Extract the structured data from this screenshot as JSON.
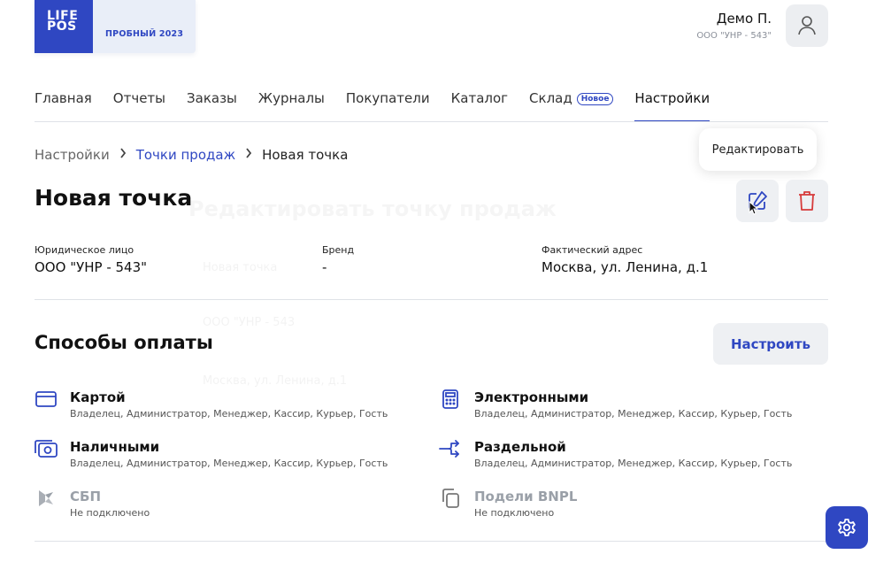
{
  "brand": {
    "logo_line1": "LIFE",
    "logo_line2": "POS",
    "trial_label": "ПРОБНЫЙ 2023"
  },
  "user": {
    "name": "Демо П.",
    "org": "ООО \"УНР - 543\""
  },
  "nav": {
    "items": [
      {
        "label": "Главная"
      },
      {
        "label": "Отчеты"
      },
      {
        "label": "Заказы"
      },
      {
        "label": "Журналы"
      },
      {
        "label": "Покупатели"
      },
      {
        "label": "Каталог"
      },
      {
        "label": "Склад",
        "badge": "Новое"
      },
      {
        "label": "Настройки",
        "active": true
      }
    ]
  },
  "breadcrumb": {
    "root": "Настройки",
    "parent": "Точки продаж",
    "current": "Новая точка"
  },
  "tooltip": {
    "text": "Редактировать"
  },
  "page": {
    "title": "Новая точка",
    "ghost_title": "Редактировать точку продаж"
  },
  "details": {
    "legal_label": "Юридическое лицо",
    "legal_value": "ООО \"УНР - 543\"",
    "brand_label": "Бренд",
    "brand_value": "-",
    "address_label": "Фактический адрес",
    "address_value": "Москва, ул. Ленина, д.1"
  },
  "ghost_fields": {
    "name": "Новая точка",
    "legal": "ООО \"УНР - 543",
    "address": "Москва, ул. Ленина, д.1"
  },
  "payments": {
    "title": "Способы оплаты",
    "configure_label": "Настроить",
    "methods": [
      {
        "name": "Картой",
        "sub": "Владелец, Администратор, Менеджер, Кассир, Курьер, Гость",
        "icon": "card-icon",
        "enabled": true
      },
      {
        "name": "Электронными",
        "sub": "Владелец, Администратор, Менеджер, Кассир, Курьер, Гость",
        "icon": "calculator-icon",
        "enabled": true
      },
      {
        "name": "Наличными",
        "sub": "Владелец, Администратор, Менеджер, Кассир, Курьер, Гость",
        "icon": "cash-icon",
        "enabled": true
      },
      {
        "name": "Раздельной",
        "sub": "Владелец, Администратор, Менеджер, Кассир, Курьер, Гость",
        "icon": "split-icon",
        "enabled": true
      },
      {
        "name": "СБП",
        "sub": "Не подключено",
        "icon": "sbp-icon",
        "enabled": false
      },
      {
        "name": "Подели BNPL",
        "sub": "Не подключено",
        "icon": "bnpl-icon",
        "enabled": false
      }
    ]
  },
  "colors": {
    "accent": "#2f47c2",
    "danger": "#d63a3a",
    "muted": "#9aa0a8"
  }
}
